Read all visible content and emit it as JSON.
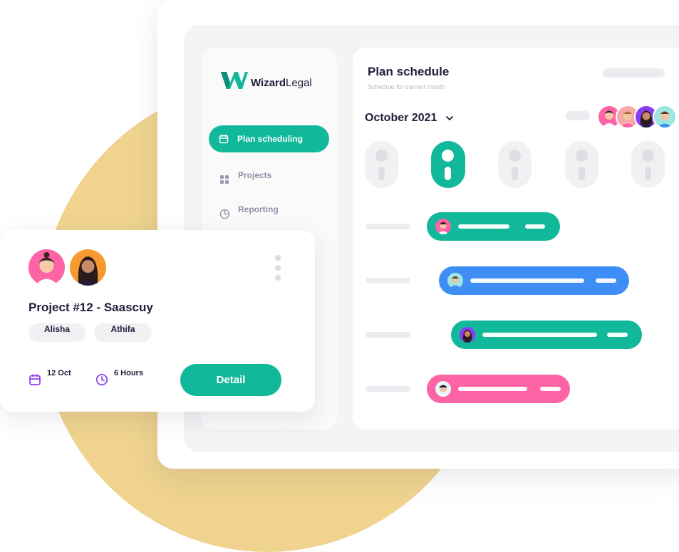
{
  "brand": {
    "name_bold": "Wizard",
    "name_regular": "Legal",
    "color": "#12b89a"
  },
  "sidebar": {
    "items": [
      {
        "label": "Plan scheduling",
        "icon": "calendar-icon",
        "active": true
      },
      {
        "label": "Projects",
        "icon": "grid-icon",
        "active": false
      },
      {
        "label": "Reporting",
        "icon": "pie-chart-icon",
        "active": false
      }
    ]
  },
  "main": {
    "title": "Plan schedule",
    "subtitle": "Schedule for current month",
    "month_label": "October 2021",
    "task_colors": [
      "#12b89a",
      "#3f8ef5",
      "#12b89a",
      "#fd63a5"
    ]
  },
  "card": {
    "title": "Project #12 - Saascuy",
    "members": [
      "Alisha",
      "Athifa"
    ],
    "date": "12 Oct",
    "duration": "6 Hours",
    "detail_label": "Detail"
  },
  "colors": {
    "accent": "#12b89a",
    "blue": "#3f8ef5",
    "pink": "#fd63a5",
    "purple": "#8a3df0",
    "blob": "#efd38f",
    "text": "#1f1d3a"
  }
}
